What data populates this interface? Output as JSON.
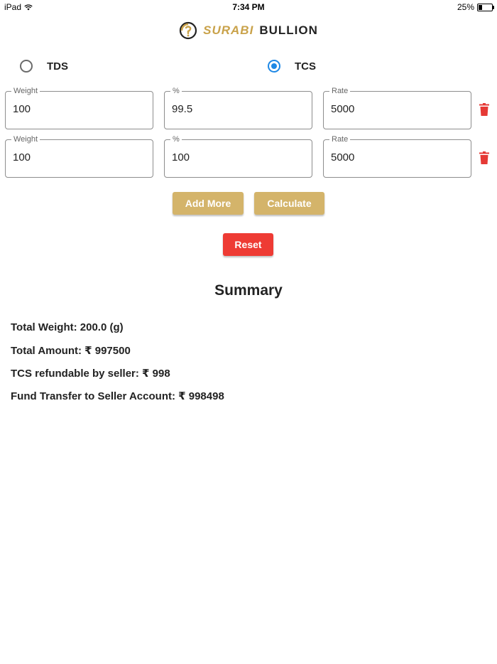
{
  "status_bar": {
    "device": "iPad",
    "time": "7:34 PM",
    "battery": "25%",
    "battery_level": 0.25
  },
  "logo": {
    "word1": "SURABI",
    "word2": "BULLION",
    "accent": "#c9a24a"
  },
  "tax_options": [
    {
      "label": "TDS",
      "selected": false
    },
    {
      "label": "TCS",
      "selected": true
    }
  ],
  "rows": [
    {
      "weight_label": "Weight",
      "weight": "100",
      "percent_label": "%",
      "percent": "99.5",
      "rate_label": "Rate",
      "rate": "5000"
    },
    {
      "weight_label": "Weight",
      "weight": "100",
      "percent_label": "%",
      "percent": "100",
      "rate_label": "Rate",
      "rate": "5000"
    }
  ],
  "buttons": {
    "add_more": "Add More",
    "calculate": "Calculate",
    "reset": "Reset"
  },
  "summary": {
    "title": "Summary",
    "total_weight": "Total Weight: 200.0 (g)",
    "total_amount": "Total Amount: ₹ 997500",
    "tcs_refundable": "TCS refundable by seller: ₹ 998",
    "fund_transfer": "Fund Transfer to Seller Account: ₹ 998498"
  },
  "colors": {
    "gold_button": "#d4b46a",
    "reset_button": "#ee3b34",
    "radio_selected": "#1e88e5",
    "delete_icon": "#e53935"
  }
}
